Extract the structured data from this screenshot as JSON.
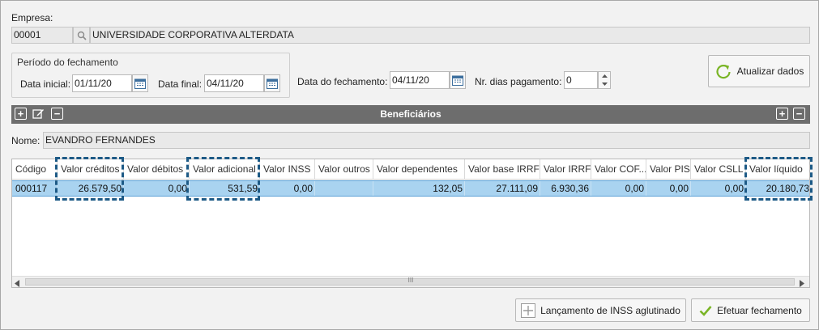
{
  "empresa": {
    "label": "Empresa:",
    "code": "00001",
    "name": "UNIVERSIDADE CORPORATIVA ALTERDATA"
  },
  "periodo": {
    "title": "Período do fechamento",
    "data_inicial_label": "Data inicial:",
    "data_inicial_value": "01/11/20",
    "data_final_label": "Data final:",
    "data_final_value": "04/11/20"
  },
  "fechamento": {
    "data_label": "Data do fechamento:",
    "data_value": "04/11/20",
    "dias_label": "Nr. dias pagamento:",
    "dias_value": "0"
  },
  "buttons": {
    "atualizar": "Atualizar dados",
    "inss": "Lançamento de INSS aglutinado",
    "efetuar": "Efetuar fechamento"
  },
  "beneficiarios": {
    "title": "Beneficiários",
    "nome_label": "Nome:",
    "nome_value": "EVANDRO FERNANDES"
  },
  "grid": {
    "columns": [
      "Código",
      "Valor créditos",
      "Valor débitos",
      "Valor adicional",
      "Valor INSS",
      "Valor outros",
      "Valor dependentes",
      "Valor base IRRF",
      "Valor IRRF",
      "Valor COF...",
      "Valor PIS",
      "Valor CSLL",
      "Valor líquido"
    ],
    "rows": [
      [
        "000117",
        "26.579,50",
        "0,00",
        "531,59",
        "0,00",
        "",
        "132,05",
        "27.111,09",
        "6.930,36",
        "0,00",
        "0,00",
        "0,00",
        "20.180,73"
      ]
    ],
    "scroll_grip": "III"
  },
  "colors": {
    "selected_row": "#a9d3f0",
    "header_bar": "#6d6d6d",
    "highlight_dash": "#1d5a86",
    "refresh_icon": "#7ab526",
    "check_icon": "#7ab526"
  }
}
